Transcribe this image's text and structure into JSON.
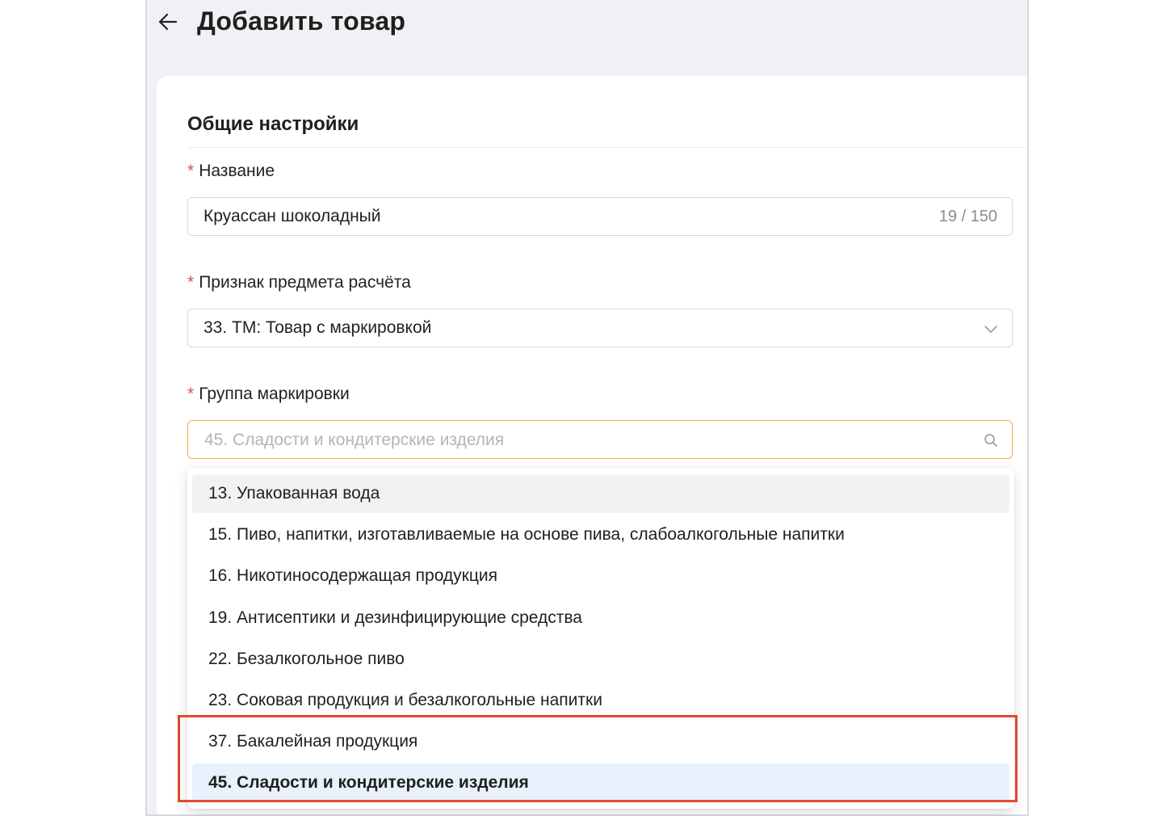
{
  "header": {
    "title": "Добавить товар",
    "back_icon": "arrow-left-icon"
  },
  "section": {
    "title": "Общие настройки"
  },
  "fields": {
    "name": {
      "label": "Название",
      "required_mark": "*",
      "value": "Круассан шоколадный",
      "counter": "19 / 150"
    },
    "payment_subject": {
      "label": "Признак предмета расчёта",
      "required_mark": "*",
      "value": "33. ТМ: Товар с маркировкой",
      "icon": "chevron-down-icon"
    },
    "marking_group": {
      "label": "Группа маркировки",
      "required_mark": "*",
      "placeholder": "45. Сладости и кондитерские изделия",
      "icon": "search-icon",
      "focus_color": "#f5b340"
    }
  },
  "dropdown": {
    "options": [
      "13. Упакованная вода",
      "15. Пиво, напитки, изготавливаемые на основе пива, слабоалкогольные напитки",
      "16. Никотиносодержащая продукция",
      "19. Антисептики и дезинфицирующие средства",
      "22. Безалкогольное пиво",
      "23. Соковая продукция и безалкогольные напитки",
      "37. Бакалейная продукция",
      "45. Сладости и кондитерские изделия"
    ],
    "hovered_index": 0,
    "selected_index": 7
  },
  "colors": {
    "required": "#e5484d",
    "selected_bg": "#e8f1fc",
    "highlight_border": "#e04a2f"
  }
}
